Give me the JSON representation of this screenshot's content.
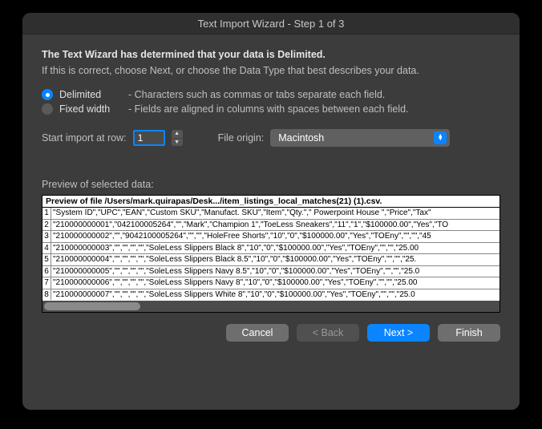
{
  "title": "Text Import Wizard - Step 1 of 3",
  "heading": "The Text Wizard has determined that your data is Delimited.",
  "sub": "If this is correct, choose Next, or choose the Data Type that best describes your data.",
  "options": {
    "delimited": {
      "label": "Delimited",
      "desc": "- Characters such as commas or tabs separate each field.",
      "checked": true
    },
    "fixed": {
      "label": "Fixed width",
      "desc": "- Fields are aligned in columns with spaces between each field.",
      "checked": false
    }
  },
  "controls": {
    "start_row_label": "Start import at row:",
    "start_row_value": "1",
    "file_origin_label": "File origin:",
    "file_origin_value": "Macintosh"
  },
  "preview": {
    "section_label": "Preview of selected data:",
    "header": "Preview of file /Users/mark.quirapas/Desk.../item_listings_local_matches(21) (1).csv.",
    "rows": [
      {
        "n": "1",
        "t": "\"System ID\",\"UPC\",\"EAN\",\"Custom SKU\",\"Manufact. SKU\",\"Item\",\"Qty.\",\" Powerpoint House \",\"Price\",\"Tax\""
      },
      {
        "n": "2",
        "t": "\"210000000001\",\"042100005264\",\"\",\"Mark\",\"Champion 1\",\"ToeLess Sneakers\",\"11\",\"1\",\"$100000.00\",\"Yes\",\"TO"
      },
      {
        "n": "3",
        "t": "\"210000000002\",\"\",\"9042100005264\",\"\",\"\",\"HoleFree Shorts\",\"10\",\"0\",\"$100000.00\",\"Yes\",\"TOEny\",\"\",\"\",\"45"
      },
      {
        "n": "4",
        "t": "\"210000000003\",\"\",\"\",\"\",\"\",\"SoleLess Slippers Black 8\",\"10\",\"0\",\"$100000.00\",\"Yes\",\"TOEny\",\"\",\"\",\"25.00"
      },
      {
        "n": "5",
        "t": "\"210000000004\",\"\",\"\",\"\",\"\",\"SoleLess Slippers Black 8.5\",\"10\",\"0\",\"$100000.00\",\"Yes\",\"TOEny\",\"\",\"\",\"25."
      },
      {
        "n": "6",
        "t": "\"210000000005\",\"\",\"\",\"\",\"\",\"SoleLess Slippers Navy 8.5\",\"10\",\"0\",\"$100000.00\",\"Yes\",\"TOEny\",\"\",\"\",\"25.0"
      },
      {
        "n": "7",
        "t": "\"210000000006\",\"\",\"\",\"\",\"\",\"SoleLess Slippers Navy 8\",\"10\",\"0\",\"$100000.00\",\"Yes\",\"TOEny\",\"\",\"\",\"25.00"
      },
      {
        "n": "8",
        "t": "\"210000000007\",\"\",\"\",\"\",\"\",\"SoleLess Slippers White 8\",\"10\",\"0\",\"$100000.00\",\"Yes\",\"TOEny\",\"\",\"\",\"25.0"
      }
    ]
  },
  "buttons": {
    "cancel": "Cancel",
    "back": "< Back",
    "next": "Next >",
    "finish": "Finish"
  }
}
